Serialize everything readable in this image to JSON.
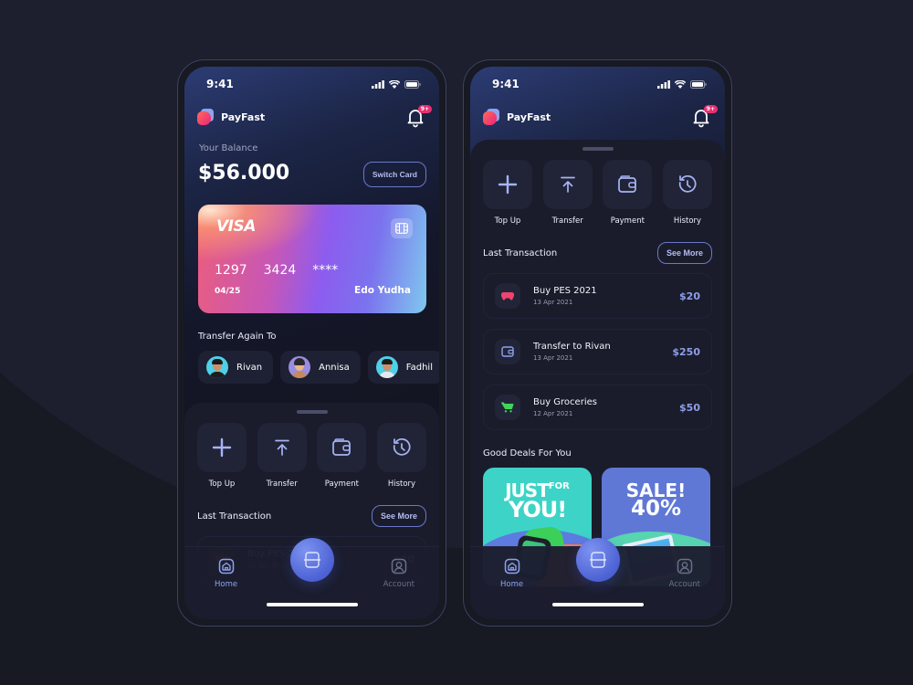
{
  "status_bar": {
    "time": "9:41"
  },
  "app": {
    "name": "PayFast",
    "notification_badge": "9+"
  },
  "balance": {
    "label": "Your Balance",
    "value": "$56.000",
    "switch_card_label": "Switch Card"
  },
  "card": {
    "brand": "VISA",
    "number_groups": [
      "1297",
      "3424",
      "****"
    ],
    "expiry": "04/25",
    "holder": "Edo Yudha"
  },
  "transfer_again": {
    "title": "Transfer Again To",
    "contacts": [
      {
        "name": "Rivan",
        "avatar_bg": "#4fd0e8"
      },
      {
        "name": "Annisa",
        "avatar_bg": "#9a8ce0"
      },
      {
        "name": "Fadhil",
        "avatar_bg": "#4fd0e8"
      }
    ]
  },
  "actions": [
    {
      "label": "Top Up",
      "icon": "plus-icon"
    },
    {
      "label": "Transfer",
      "icon": "upload-icon"
    },
    {
      "label": "Payment",
      "icon": "wallet-icon"
    },
    {
      "label": "History",
      "icon": "history-icon"
    }
  ],
  "transactions": {
    "title": "Last Transaction",
    "see_more_label": "See More",
    "items": [
      {
        "name": "Buy PES 2021",
        "date": "13 Apr 2021",
        "amount": "$20",
        "icon": "gamepad-icon",
        "icon_color": "#f0436f"
      },
      {
        "name": "Transfer to Rivan",
        "date": "13 Apr 2021",
        "amount": "$250",
        "icon": "wallet-icon",
        "icon_color": "#8ea2ef"
      },
      {
        "name": "Buy Groceries",
        "date": "12 Apr 2021",
        "amount": "$50",
        "icon": "cart-icon",
        "icon_color": "#3ed65a"
      }
    ]
  },
  "deals": {
    "title": "Good Deals For You",
    "items": [
      {
        "line1_big": "JUST",
        "line1_small": "FOR",
        "line2": "YOU!"
      },
      {
        "line1": "SALE!",
        "line2": "40%"
      }
    ]
  },
  "nav": {
    "home_label": "Home",
    "account_label": "Account"
  },
  "colors": {
    "accent": "#8ea2ef",
    "background": "#171923",
    "badge": "#ec2e70"
  }
}
